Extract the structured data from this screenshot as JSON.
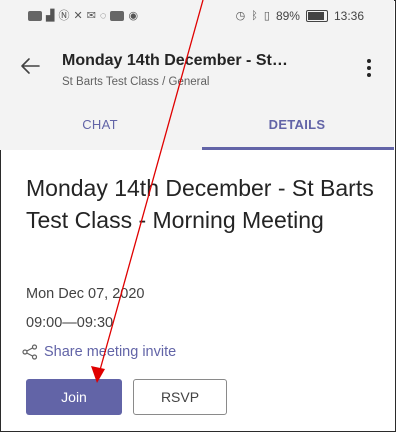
{
  "status_bar": {
    "left_icons": [
      "sim-icon",
      "signal-icon",
      "nfc-icon",
      "missed-call-icon",
      "mail-icon",
      "whatsapp-icon",
      "gallery-icon",
      "chrome-icon"
    ],
    "right_text": "89%",
    "time": "13:36",
    "battery_level": 0.89
  },
  "header": {
    "title": "Monday 14th December - St…",
    "subtitle": "St Barts Test Class / General"
  },
  "tabs": [
    {
      "label": "CHAT",
      "selected": false
    },
    {
      "label": "DETAILS",
      "selected": true
    }
  ],
  "meeting": {
    "title": "Monday 14th December - St Barts Test Class - Morning Meeting",
    "date": "Mon Dec 07, 2020",
    "time": "09:00—09:30",
    "share_label": "Share meeting invite"
  },
  "actions": {
    "join_label": "Join",
    "rsvp_label": "RSVP"
  },
  "colors": {
    "accent": "#6264a7",
    "annotation": "#e00000"
  }
}
